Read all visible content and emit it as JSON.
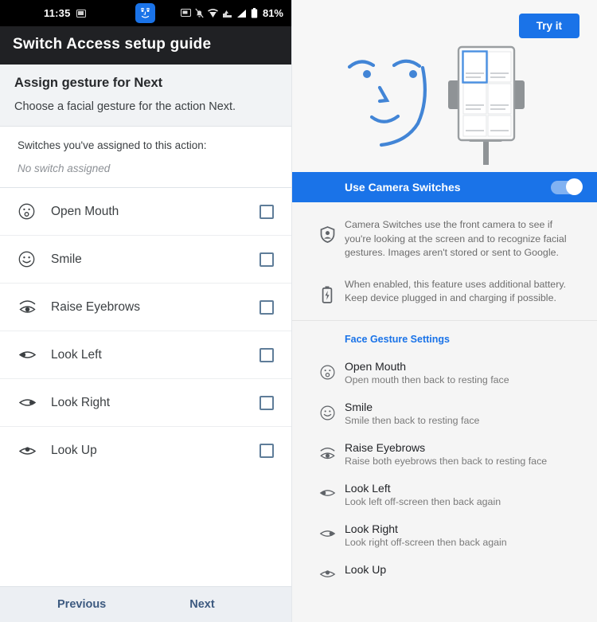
{
  "left": {
    "status_bar": {
      "time": "11:35",
      "mail_icon": "envelope-icon",
      "face_icon": "camera-switches-face-icon",
      "icons": [
        "screenshot-icon",
        "notifications-muted-icon",
        "wifi-icon",
        "vpn-icon",
        "signal-icon",
        "battery-icon"
      ],
      "battery": "81%"
    },
    "app_bar": {
      "title": "Switch Access setup guide"
    },
    "section": {
      "heading": "Assign gesture for Next",
      "subheading": "Choose a facial gesture for the action Next."
    },
    "assigned": {
      "title": "Switches you've assigned to this action:",
      "value": "No switch assigned"
    },
    "gestures": [
      {
        "icon": "open-mouth-face-icon",
        "label": "Open Mouth",
        "checked": false
      },
      {
        "icon": "smile-face-icon",
        "label": "Smile",
        "checked": false
      },
      {
        "icon": "raise-eyebrows-icon",
        "label": "Raise Eyebrows",
        "checked": false
      },
      {
        "icon": "look-left-eye-icon",
        "label": "Look Left",
        "checked": false
      },
      {
        "icon": "look-right-eye-icon",
        "label": "Look Right",
        "checked": false
      },
      {
        "icon": "look-up-eye-icon",
        "label": "Look Up",
        "checked": false
      }
    ],
    "nav": {
      "previous": "Previous",
      "next": "Next"
    }
  },
  "right": {
    "hero": {
      "try_it": "Try it",
      "illustration": "face-and-phone-on-stand-illustration"
    },
    "toggle": {
      "label": "Use Camera Switches",
      "state": "on"
    },
    "info": [
      {
        "icon": "privacy-shield-icon",
        "text": "Camera Switches use the front camera to see if you're looking at the screen and to recognize facial gestures. Images aren't stored or sent to Google."
      },
      {
        "icon": "battery-charging-icon",
        "text": "When enabled, this feature uses additional battery. Keep device plugged in and charging if possible."
      }
    ],
    "settings": {
      "title": "Face Gesture Settings",
      "items": [
        {
          "icon": "open-mouth-face-icon",
          "name": "Open Mouth",
          "desc": "Open mouth then back to resting face"
        },
        {
          "icon": "smile-face-icon",
          "name": "Smile",
          "desc": "Smile then back to resting face"
        },
        {
          "icon": "raise-eyebrows-icon",
          "name": "Raise Eyebrows",
          "desc": "Raise both eyebrows then back to resting face"
        },
        {
          "icon": "look-left-eye-icon",
          "name": "Look Left",
          "desc": "Look left off-screen then back again"
        },
        {
          "icon": "look-right-eye-icon",
          "name": "Look Right",
          "desc": "Look right off-screen then back again"
        },
        {
          "icon": "look-up-eye-icon",
          "name": "Look Up",
          "desc": ""
        }
      ]
    }
  },
  "colors": {
    "accent_blue": "#1a73e8",
    "app_bar": "#202124",
    "status_bar": "#000000",
    "nav_link": "#3d5a80",
    "checkbox_border": "#5f7d99"
  }
}
